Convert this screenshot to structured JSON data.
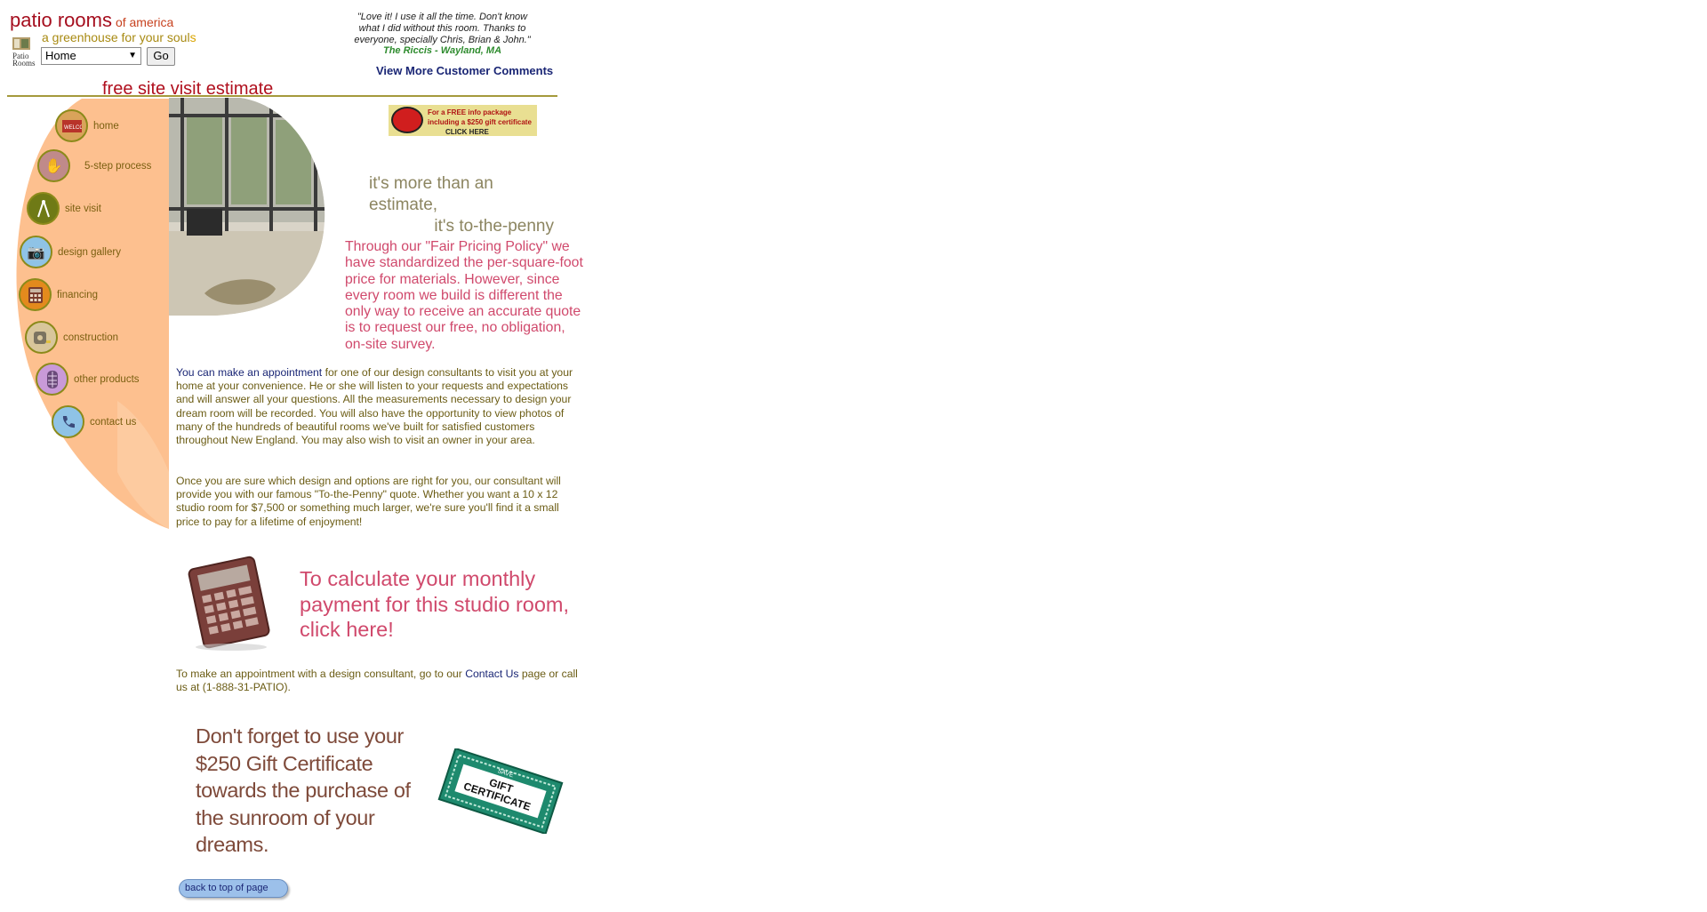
{
  "header": {
    "brand": "patio rooms",
    "brand_suffix": "of america",
    "tagline": "a greenhouse for your soul",
    "tagline_end": "s",
    "nav_select_value": "Home",
    "go_label": "Go"
  },
  "testimonial": {
    "quote": "\"Love it! I use it all the time. Don't know what I did without this room. Thanks to everyone, specially Chris, Brian & John.\"",
    "author": "The Riccis - Wayland, MA",
    "more_link": "View More Customer Comments"
  },
  "page_banner": "free site visit estimate",
  "nav": {
    "items": [
      {
        "label": "home",
        "icon": "welcome-mat-icon"
      },
      {
        "label": "5-step process",
        "icon": "hand-icon"
      },
      {
        "label": "site visit",
        "icon": "compass-icon"
      },
      {
        "label": "design gallery",
        "icon": "camera-icon"
      },
      {
        "label": "financing",
        "icon": "calculator-icon"
      },
      {
        "label": "construction",
        "icon": "tape-measure-icon"
      },
      {
        "label": "other products",
        "icon": "window-icon"
      },
      {
        "label": "contact us",
        "icon": "phone-icon"
      }
    ]
  },
  "info_banner": {
    "line1": "For a FREE info package",
    "line2": "including a $250 gift certificate",
    "cta": "CLICK HERE"
  },
  "tagline": {
    "line1": "it's more than an estimate,",
    "line2": "it's to-the-penny"
  },
  "pricing_text": "Through our \"Fair Pricing Policy\" we have standardized the per-square-foot price for materials. However, since every room we build is different the only way to receive an accurate quote is to request our free, no obligation, on-site survey.",
  "paragraph1": {
    "link": "You can make an appointment",
    "rest": " for one of our design consultants to visit you at your home at your convenience. He or she will listen to your requests and expectations and will answer all your questions. All the measurements necessary to design your dream room will be recorded. You will also have the opportunity to view photos of many of the hundreds of beautiful rooms we've built for satisfied customers throughout New England. You may also wish to visit an owner in your area."
  },
  "paragraph2": "Once you are sure which design and options are right for you, our consultant will provide you with our famous \"To-the-Penny\" quote. Whether you want a 10 x 12 studio room for $7,500 or something much larger, we're sure you'll find it a small price to pay for a lifetime of enjoyment!",
  "calc_cta": "To calculate your monthly payment for this studio room, click here!",
  "paragraph3": {
    "before": "To make an appointment with a design consultant, go to our ",
    "link": "Contact Us",
    "after": " page or call us at (1-888-31-PATIO)."
  },
  "gift": {
    "text": "Don't forget to use your $250 Gift Certificate towards the purchase of the sunroom of your dreams.",
    "cert_top": "SAVE",
    "cert_line1": "GIFT",
    "cert_line2": "CERTIFICATE"
  },
  "back_to_top": "back to top of page",
  "colors": {
    "brand_red": "#a50e1e",
    "pink_text": "#d0496c",
    "olive_text": "#6b5c14",
    "link_blue": "#1a2675",
    "nav_peach": "#fdc08f"
  }
}
